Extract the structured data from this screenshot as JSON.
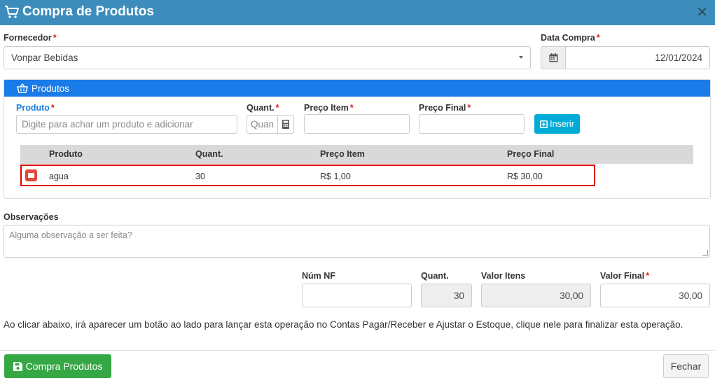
{
  "header": {
    "title": "Compra de Produtos",
    "close_glyph": "✕"
  },
  "fornecedor": {
    "label": "Fornecedor",
    "value": "Vonpar Bebidas"
  },
  "data_compra": {
    "label": "Data Compra",
    "value": "12/01/2024"
  },
  "required_mark": "*",
  "produtos_panel": {
    "title": "Produtos",
    "produto_label": "Produto",
    "produto_placeholder": "Digite para achar um produto e adicionar",
    "quant_label": "Quant.",
    "quant_placeholder": "Quan",
    "preco_item_label": "Preço Item",
    "preco_final_label": "Preço Final",
    "insert_button": "Inserir"
  },
  "table": {
    "headers": [
      "Produto",
      "Quant.",
      "Preço Item",
      "Preço Final"
    ],
    "rows": [
      {
        "produto": "agua",
        "quant": "30",
        "preco_item": "R$ 1,00",
        "preco_final": "R$ 30,00"
      }
    ]
  },
  "observacoes": {
    "label": "Observações",
    "placeholder": "Alguma observação a ser feita?"
  },
  "totals": {
    "num_nf_label": "Núm NF",
    "num_nf_value": "",
    "quant_label": "Quant.",
    "quant_value": "30",
    "valor_itens_label": "Valor Itens",
    "valor_itens_value": "30,00",
    "valor_final_label": "Valor Final",
    "valor_final_value": "30,00"
  },
  "notice": "Ao clicar abaixo, irá aparecer um botão ao lado para lançar esta operação no Contas Pagar/Receber e Ajustar o Estoque, clique nele para finalizar esta operação.",
  "footer": {
    "submit_label": "Compra Produtos",
    "close_label": "Fechar"
  },
  "colors": {
    "header": "#3c8dbc",
    "panel": "#1a7ce8",
    "insert": "#00acd6",
    "submit": "#35a845",
    "danger": "#dd4b39"
  }
}
